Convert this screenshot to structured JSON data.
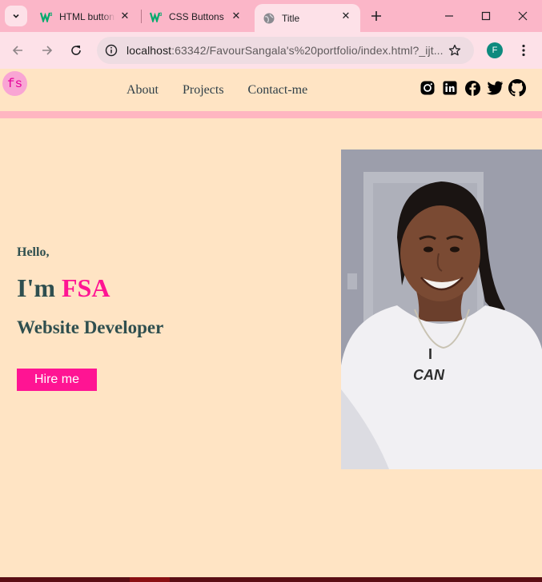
{
  "browser": {
    "tabs": [
      {
        "title": "HTML buttons",
        "favicon": "w3schools-icon"
      },
      {
        "title": "CSS Buttons",
        "favicon": "w3schools-icon"
      },
      {
        "title": "Title",
        "favicon": "globe-icon",
        "active": true
      }
    ],
    "url_host": "localhost",
    "url_rest": ":63342/FavourSangala's%20portfolio/index.html?_ijt...",
    "profile_initial": "F",
    "colors": {
      "tabstrip": "#fbb6c8",
      "toolbar": "#fde1e8",
      "profile": "#0e8a7e"
    }
  },
  "page": {
    "logo": "fs",
    "nav": [
      "About",
      "Projects",
      "Contact-me"
    ],
    "socials": [
      "instagram-icon",
      "linkedin-icon",
      "facebook-icon",
      "twitter-icon",
      "github-icon"
    ],
    "hero": {
      "greeting": "Hello,",
      "intro_prefix": "I'm ",
      "intro_name": "FSA",
      "role": "Website Developer",
      "cta": "Hire me",
      "shirt_text_line1": "I",
      "shirt_text_line2": "CAN"
    },
    "colors": {
      "background": "#ffe4c4",
      "accent": "#ff1493",
      "heading": "#2f4f4f",
      "divider": "#ffb6c1"
    }
  }
}
